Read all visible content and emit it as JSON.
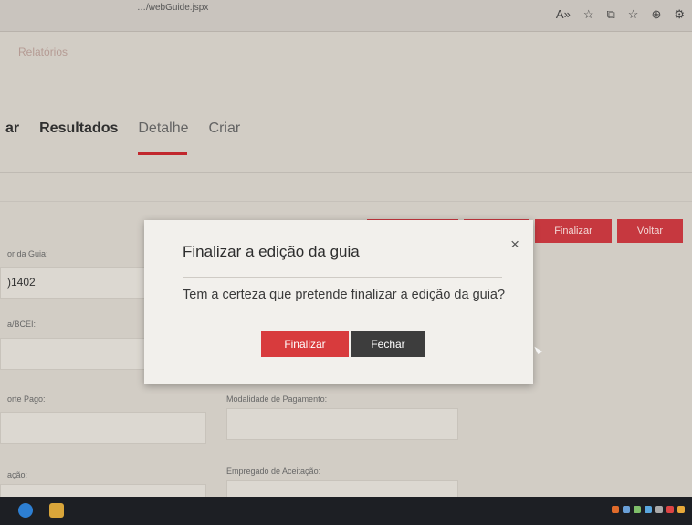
{
  "browser": {
    "url": "…/webGuide.jspx",
    "icons": [
      "read-aloud-icon",
      "star-icon",
      "split-screen-icon",
      "favorites-icon",
      "collections-icon",
      "extensions-icon"
    ],
    "icon_glyphs": [
      "A»",
      "☆",
      "⧉",
      "☆",
      "⊕",
      "⚙"
    ]
  },
  "app": {
    "section_title": "Relatórios"
  },
  "tabs": [
    {
      "label": "ar"
    },
    {
      "label": "Resultados"
    },
    {
      "label": "Detalhe"
    },
    {
      "label": "Criar"
    }
  ],
  "actions": [
    {
      "label": ""
    },
    {
      "label": ""
    },
    {
      "label": "Finalizar"
    },
    {
      "label": "Voltar"
    }
  ],
  "form": {
    "guide_number_label": "or da Guia:",
    "guide_number_value": ")1402",
    "bcei_label": "a/BCEI:",
    "amount_paid_label": "orte Pago:",
    "payment_method_label": "Modalidade de Pagamento:",
    "acceptance_label": "ação:",
    "acceptance_employee_label": "Empregado de Aceitação:"
  },
  "modal": {
    "title": "Finalizar a edição da guia",
    "close_glyph": "×",
    "message": "Tem a certeza que pretende finalizar a edição da guia?",
    "confirm_label": "Finalizar",
    "cancel_label": "Fechar"
  },
  "colors": {
    "accent": "#d83b3d",
    "dark_button": "#3d3d3d",
    "tab_underline": "#c1272d"
  }
}
